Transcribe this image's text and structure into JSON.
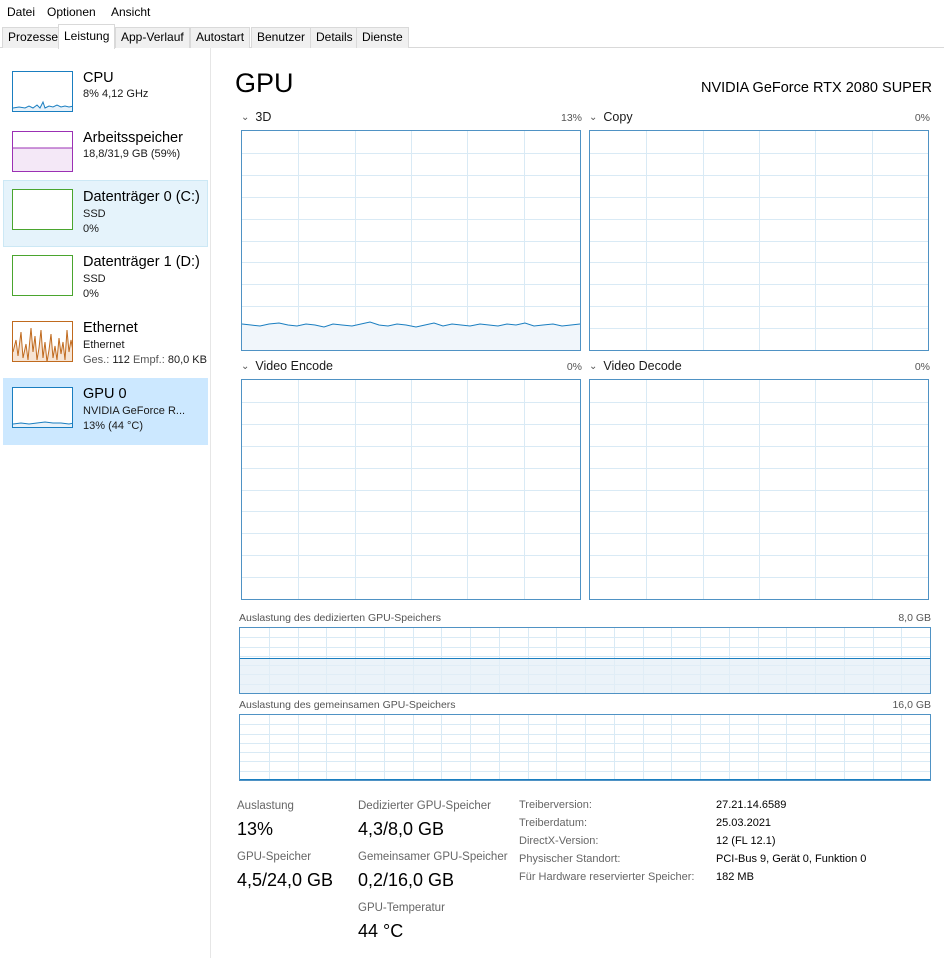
{
  "menu": [
    "Datei",
    "Optionen",
    "Ansicht"
  ],
  "tabs": [
    "Prozesse",
    "Leistung",
    "App-Verlauf",
    "Autostart",
    "Benutzer",
    "Details",
    "Dienste"
  ],
  "active_tab": "Leistung",
  "sidebar": {
    "cpu": {
      "title": "CPU",
      "line1": "8% 4,12 GHz",
      "color": "#1a7ec0"
    },
    "memory": {
      "title": "Arbeitsspeicher",
      "line1": "18,8/31,9 GB (59%)",
      "color": "#9b30b4"
    },
    "disk0": {
      "title": "Datenträger 0 (C:)",
      "line1": "SSD",
      "line2": "0%",
      "color": "#4aa52e"
    },
    "disk1": {
      "title": "Datenträger 1 (D:)",
      "line1": "SSD",
      "line2": "0%",
      "color": "#4aa52e"
    },
    "ethernet": {
      "title": "Ethernet",
      "line1": "Ethernet",
      "line2_label1": "Ges.:",
      "line2_val1": "112",
      "line2_label2": "Empf.:",
      "line2_val2": "80,0 KB",
      "color": "#c06a1e"
    },
    "gpu": {
      "title": "GPU 0",
      "line1": "NVIDIA GeForce R...",
      "line2": "13% (44 °C)",
      "color": "#1a7ec0"
    }
  },
  "main": {
    "title": "GPU",
    "model": "NVIDIA GeForce RTX 2080 SUPER",
    "panels": {
      "p3d": {
        "label": "3D",
        "pct": "13%"
      },
      "copy": {
        "label": "Copy",
        "pct": "0%"
      },
      "encode": {
        "label": "Video Encode",
        "pct": "0%"
      },
      "decode": {
        "label": "Video Decode",
        "pct": "0%"
      }
    },
    "dedicated": {
      "label": "Auslastung des dedizierten GPU-Speichers",
      "max": "8,0 GB",
      "used_fraction": 0.54
    },
    "shared": {
      "label": "Auslastung des gemeinsamen GPU-Speichers",
      "max": "16,0 GB",
      "used_fraction": 0.01
    },
    "stats": {
      "util_label": "Auslastung",
      "util_value": "13%",
      "gpumem_label": "GPU-Speicher",
      "gpumem_value": "4,5/24,0 GB",
      "ded_label": "Dedizierter GPU-Speicher",
      "ded_value": "4,3/8,0 GB",
      "shared_label": "Gemeinsamer GPU-Speicher",
      "shared_value": "0,2/16,0 GB",
      "temp_label": "GPU-Temperatur",
      "temp_value": "44 °C"
    },
    "info": [
      {
        "key": "Treiberversion:",
        "value": "27.21.14.6589"
      },
      {
        "key": "Treiberdatum:",
        "value": "25.03.2021"
      },
      {
        "key": "DirectX-Version:",
        "value": "12 (FL 12.1)"
      },
      {
        "key": "Physischer Standort:",
        "value": "PCI-Bus 9, Gerät 0, Funktion 0"
      },
      {
        "key": "Für Hardware reservierter Speicher:",
        "value": "182 MB"
      }
    ]
  }
}
